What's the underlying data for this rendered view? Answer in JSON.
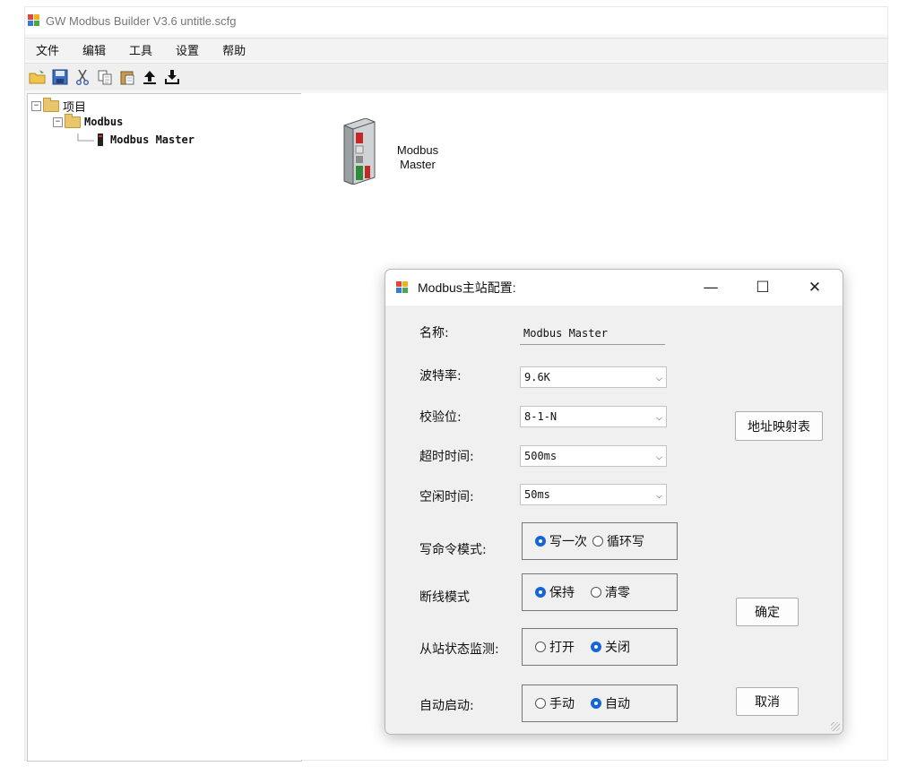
{
  "window": {
    "title": "GW Modbus Builder V3.6  untitle.scfg"
  },
  "menu": {
    "items": [
      "文件",
      "编辑",
      "工具",
      "设置",
      "帮助"
    ]
  },
  "toolbar": {
    "icons": [
      "open-folder-icon",
      "save-icon",
      "cut-icon",
      "copy-icon",
      "paste-icon",
      "upload-icon",
      "download-icon"
    ]
  },
  "tree": {
    "root": "项目",
    "child": "Modbus",
    "leaf": "Modbus Master"
  },
  "canvas": {
    "device_label": "Modbus\nMaster"
  },
  "dialog": {
    "title": "Modbus主站配置:",
    "controls": {
      "minimize": "—",
      "maximize": "☐",
      "close": "✕"
    },
    "name_label": "名称:",
    "name_value": "Modbus Master",
    "baud_label": "波特率:",
    "baud_value": "9.6K",
    "parity_label": "校验位:",
    "parity_value": "8-1-N",
    "timeout_label": "超时时间:",
    "timeout_value": "500ms",
    "idle_label": "空闲时间:",
    "idle_value": "50ms",
    "write_mode_label": "写命令模式:",
    "write_mode_opt1": "写一次",
    "write_mode_opt2": "循环写",
    "disconnect_label": "断线模式",
    "disconnect_opt1": "保持",
    "disconnect_opt2": "清零",
    "monitor_label": "从站状态监测:",
    "monitor_opt1": "打开",
    "monitor_opt2": "关闭",
    "autostart_label": "自动启动:",
    "autostart_opt1": "手动",
    "autostart_opt2": "自动",
    "map_button": "地址映射表",
    "ok_button": "确定",
    "cancel_button": "取消"
  },
  "colors": {
    "accent": "#1565d8",
    "folder": "#e9c66d"
  }
}
